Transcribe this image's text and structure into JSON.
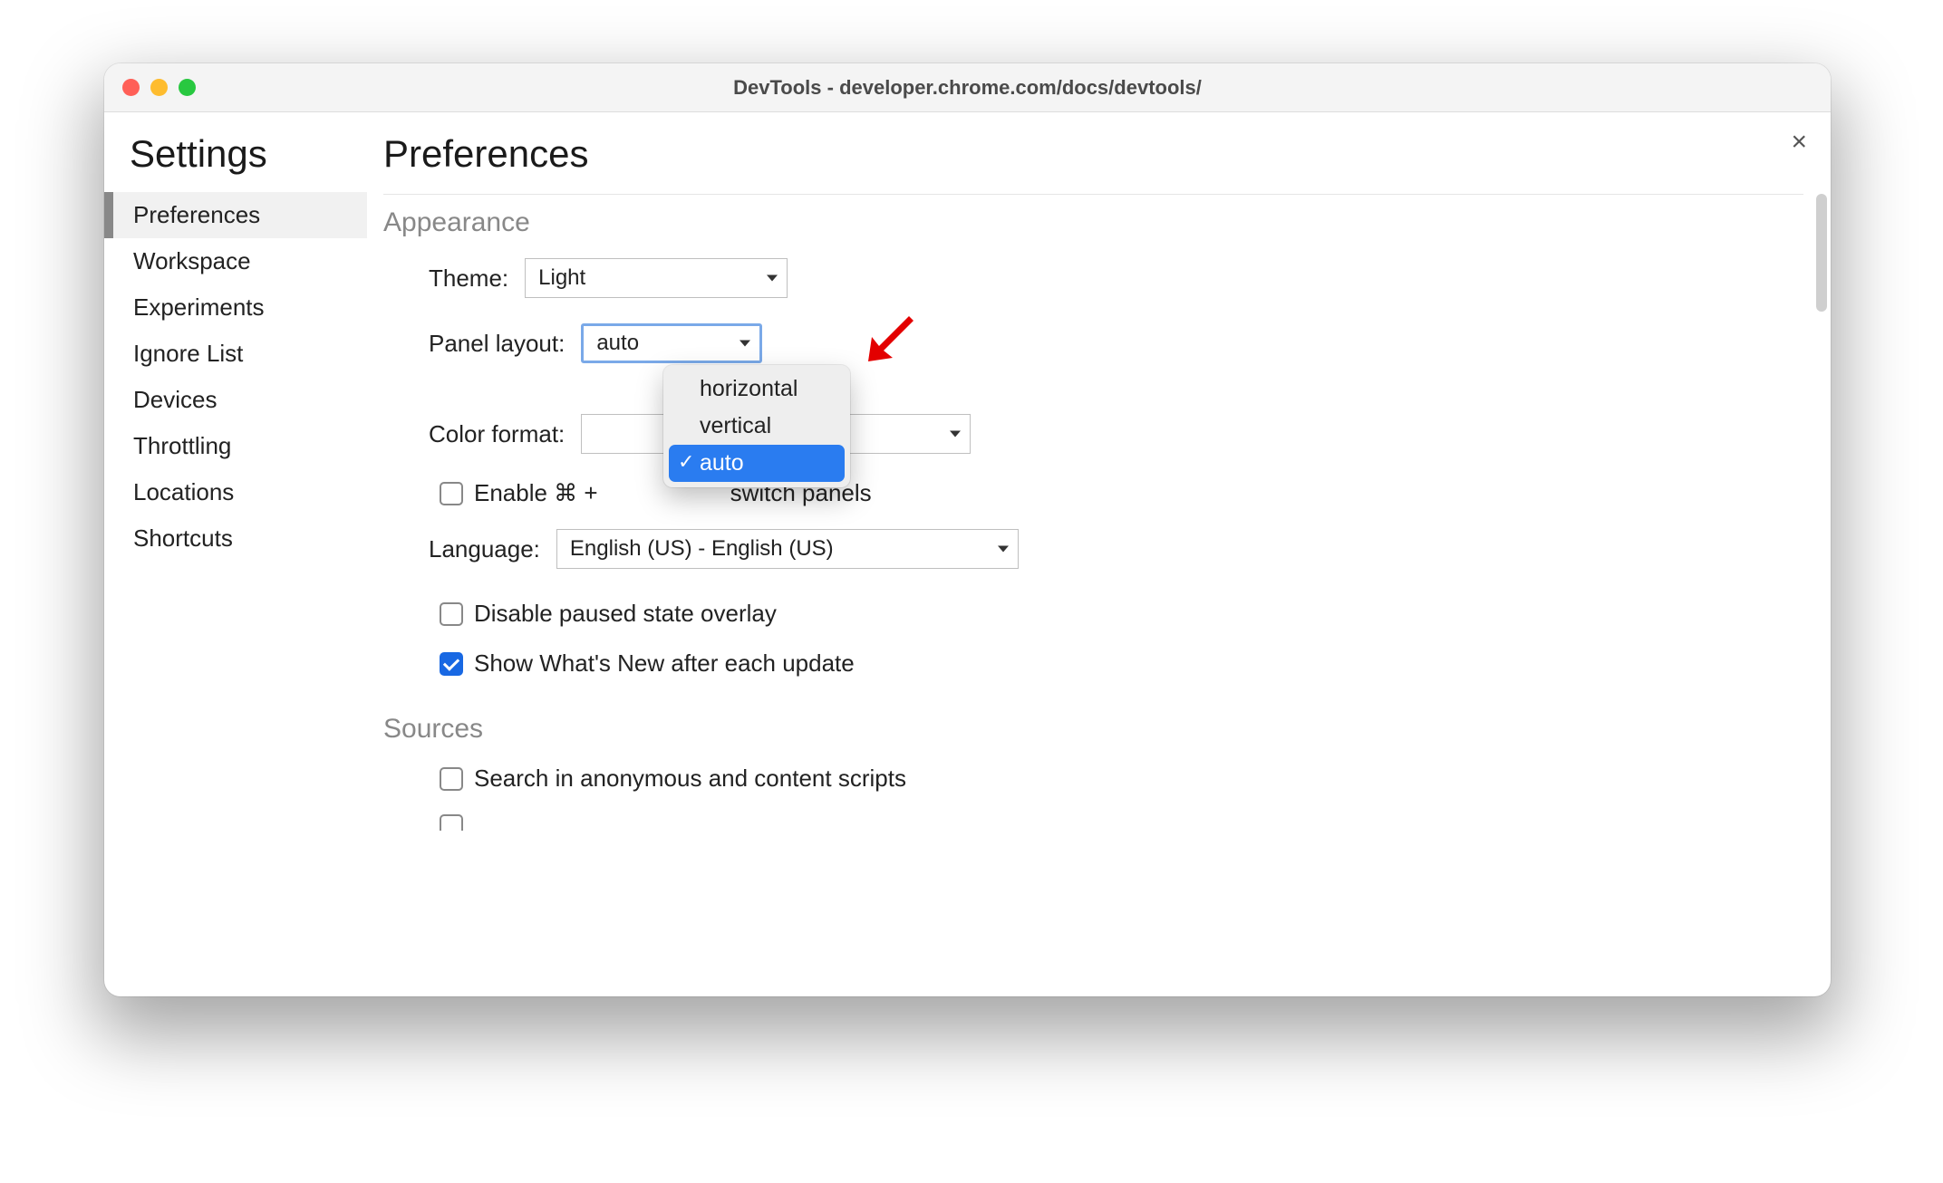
{
  "window": {
    "title": "DevTools - developer.chrome.com/docs/devtools/"
  },
  "sidebar": {
    "title": "Settings",
    "items": [
      {
        "label": "Preferences",
        "active": true
      },
      {
        "label": "Workspace",
        "active": false
      },
      {
        "label": "Experiments",
        "active": false
      },
      {
        "label": "Ignore List",
        "active": false
      },
      {
        "label": "Devices",
        "active": false
      },
      {
        "label": "Throttling",
        "active": false
      },
      {
        "label": "Locations",
        "active": false
      },
      {
        "label": "Shortcuts",
        "active": false
      }
    ]
  },
  "main": {
    "title": "Preferences",
    "close_label": "×",
    "appearance": {
      "heading": "Appearance",
      "theme": {
        "label": "Theme:",
        "value": "Light"
      },
      "panel_layout": {
        "label": "Panel layout:",
        "value": "auto",
        "options": [
          {
            "label": "horizontal",
            "selected": false
          },
          {
            "label": "vertical",
            "selected": false
          },
          {
            "label": "auto",
            "selected": true
          }
        ]
      },
      "color_format": {
        "label": "Color format:",
        "value": ""
      },
      "enable_cmd_switch": {
        "checked": false,
        "text_before": "Enable ⌘ + ",
        "text_after": " switch panels"
      },
      "language": {
        "label": "Language:",
        "value": "English (US) - English (US)"
      },
      "disable_paused_overlay": {
        "checked": false,
        "label": "Disable paused state overlay"
      },
      "show_whats_new": {
        "checked": true,
        "label": "Show What's New after each update"
      }
    },
    "sources": {
      "heading": "Sources",
      "search_anon": {
        "checked": false,
        "label": "Search in anonymous and content scripts"
      }
    }
  },
  "annotation": {
    "arrow_color": "#e30000"
  }
}
